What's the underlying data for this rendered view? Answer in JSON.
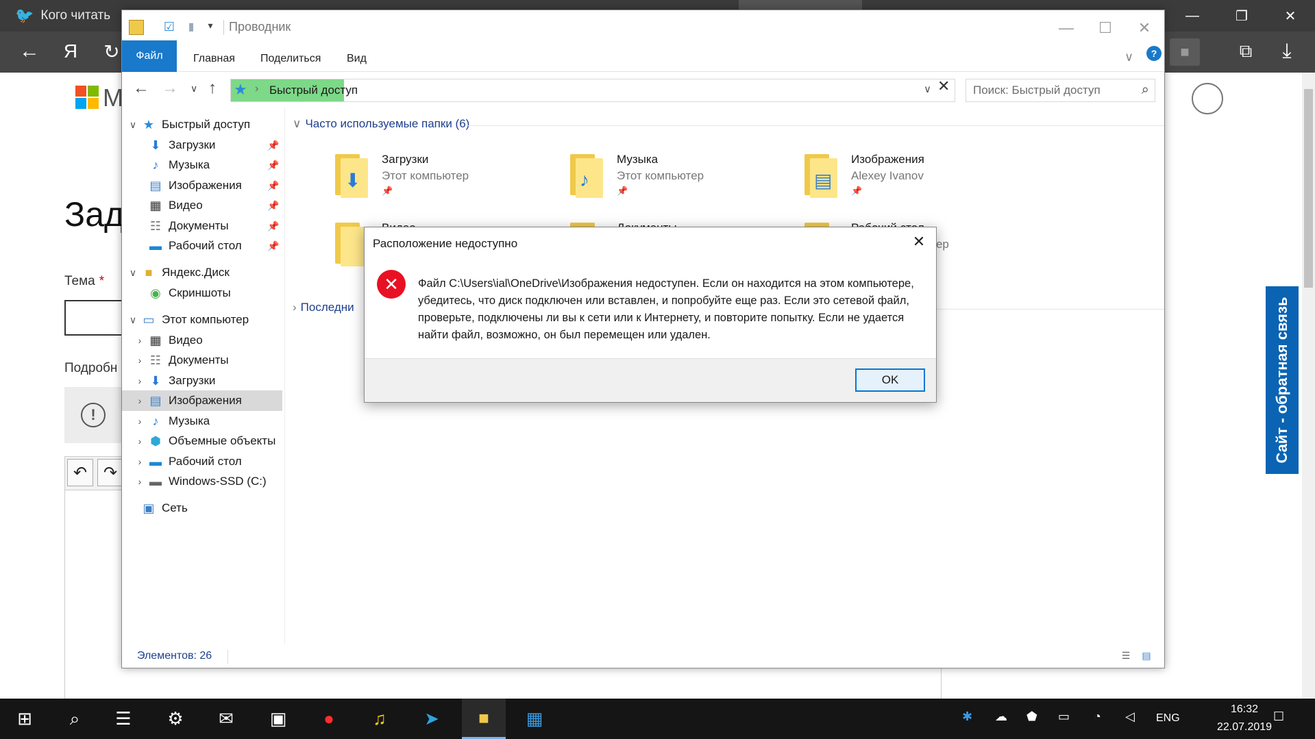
{
  "browser": {
    "tab_title": "Кого читать",
    "ya_label": "Я",
    "page_heading": "Зад",
    "topic_label": "Тема",
    "required_mark": "*",
    "detail_label": "Подробн",
    "feedback_tab": "Сайт - обратная связь",
    "logo_fragment": "M"
  },
  "explorer": {
    "title": "Проводник",
    "ribbon_tabs": [
      "Файл",
      "Главная",
      "Поделиться",
      "Вид"
    ],
    "address_path": "Быстрый доступ",
    "search_placeholder": "Поиск: Быстрый доступ",
    "nav_tree": [
      {
        "label": "Быстрый доступ",
        "icon": "star-icon",
        "level": 0,
        "expanded": true
      },
      {
        "label": "Загрузки",
        "icon": "download-icon",
        "level": 1,
        "pinned": true
      },
      {
        "label": "Музыка",
        "icon": "music-icon",
        "level": 1,
        "pinned": true
      },
      {
        "label": "Изображения",
        "icon": "pictures-icon",
        "level": 1,
        "pinned": true
      },
      {
        "label": "Видео",
        "icon": "video-icon",
        "level": 1,
        "pinned": true
      },
      {
        "label": "Документы",
        "icon": "documents-icon",
        "level": 1,
        "pinned": true
      },
      {
        "label": "Рабочий стол",
        "icon": "desktop-icon",
        "level": 1,
        "pinned": true
      },
      {
        "label": "Яндекс.Диск",
        "icon": "yandex-disk-icon",
        "level": 0,
        "expanded": true
      },
      {
        "label": "Скриншоты",
        "icon": "screenshots-folder-icon",
        "level": 1
      },
      {
        "label": "Этот компьютер",
        "icon": "computer-icon",
        "level": 0,
        "expanded": true
      },
      {
        "label": "Видео",
        "icon": "video-icon",
        "level": 1
      },
      {
        "label": "Документы",
        "icon": "documents-icon",
        "level": 1
      },
      {
        "label": "Загрузки",
        "icon": "download-icon",
        "level": 1
      },
      {
        "label": "Изображения",
        "icon": "pictures-icon",
        "level": 1,
        "selected": true
      },
      {
        "label": "Музыка",
        "icon": "music-icon",
        "level": 1
      },
      {
        "label": "Объемные объекты",
        "icon": "3d-objects-icon",
        "level": 1
      },
      {
        "label": "Рабочий стол",
        "icon": "desktop-icon",
        "level": 1
      },
      {
        "label": "Windows-SSD (C:)",
        "icon": "drive-icon",
        "level": 1
      },
      {
        "label": "Сеть",
        "icon": "network-icon",
        "level": 0
      }
    ],
    "group_frequent": "Часто используемые папки (6)",
    "group_recent": "Последни",
    "folders": [
      {
        "name": "Загрузки",
        "sub": "Этот компьютер",
        "glyph": "download-icon"
      },
      {
        "name": "Музыка",
        "sub": "Этот компьютер",
        "glyph": "music-icon"
      },
      {
        "name": "Изображения",
        "sub": "Alexey Ivanov",
        "glyph": "pictures-icon"
      },
      {
        "name": "Видео",
        "sub": "",
        "glyph": "video-icon"
      },
      {
        "name": "Документы",
        "sub": "",
        "glyph": "documents-icon"
      },
      {
        "name": "Рабочий стол",
        "sub": "ютер",
        "glyph": "desktop-icon"
      }
    ],
    "status_text": "Элементов: 26"
  },
  "dialog": {
    "title": "Расположение недоступно",
    "message": "Файл C:\\Users\\ial\\OneDrive\\Изображения недоступен. Если он находится на этом компьютере, убедитесь, что диск подключен или вставлен, и попробуйте еще раз. Если это сетевой файл, проверьте, подключены ли вы к сети или к Интернету, и повторите попытку. Если не удается найти файл, возможно, он был перемещен или удален.",
    "ok_label": "OK"
  },
  "taskbar": {
    "language": "ENG",
    "time": "16:32",
    "date": "22.07.2019"
  },
  "colors": {
    "accent": "#1979ca",
    "error": "#e81123",
    "folder": "#f0c94a",
    "address_highlight": "#7dd888",
    "feedback": "#0a64b3"
  }
}
